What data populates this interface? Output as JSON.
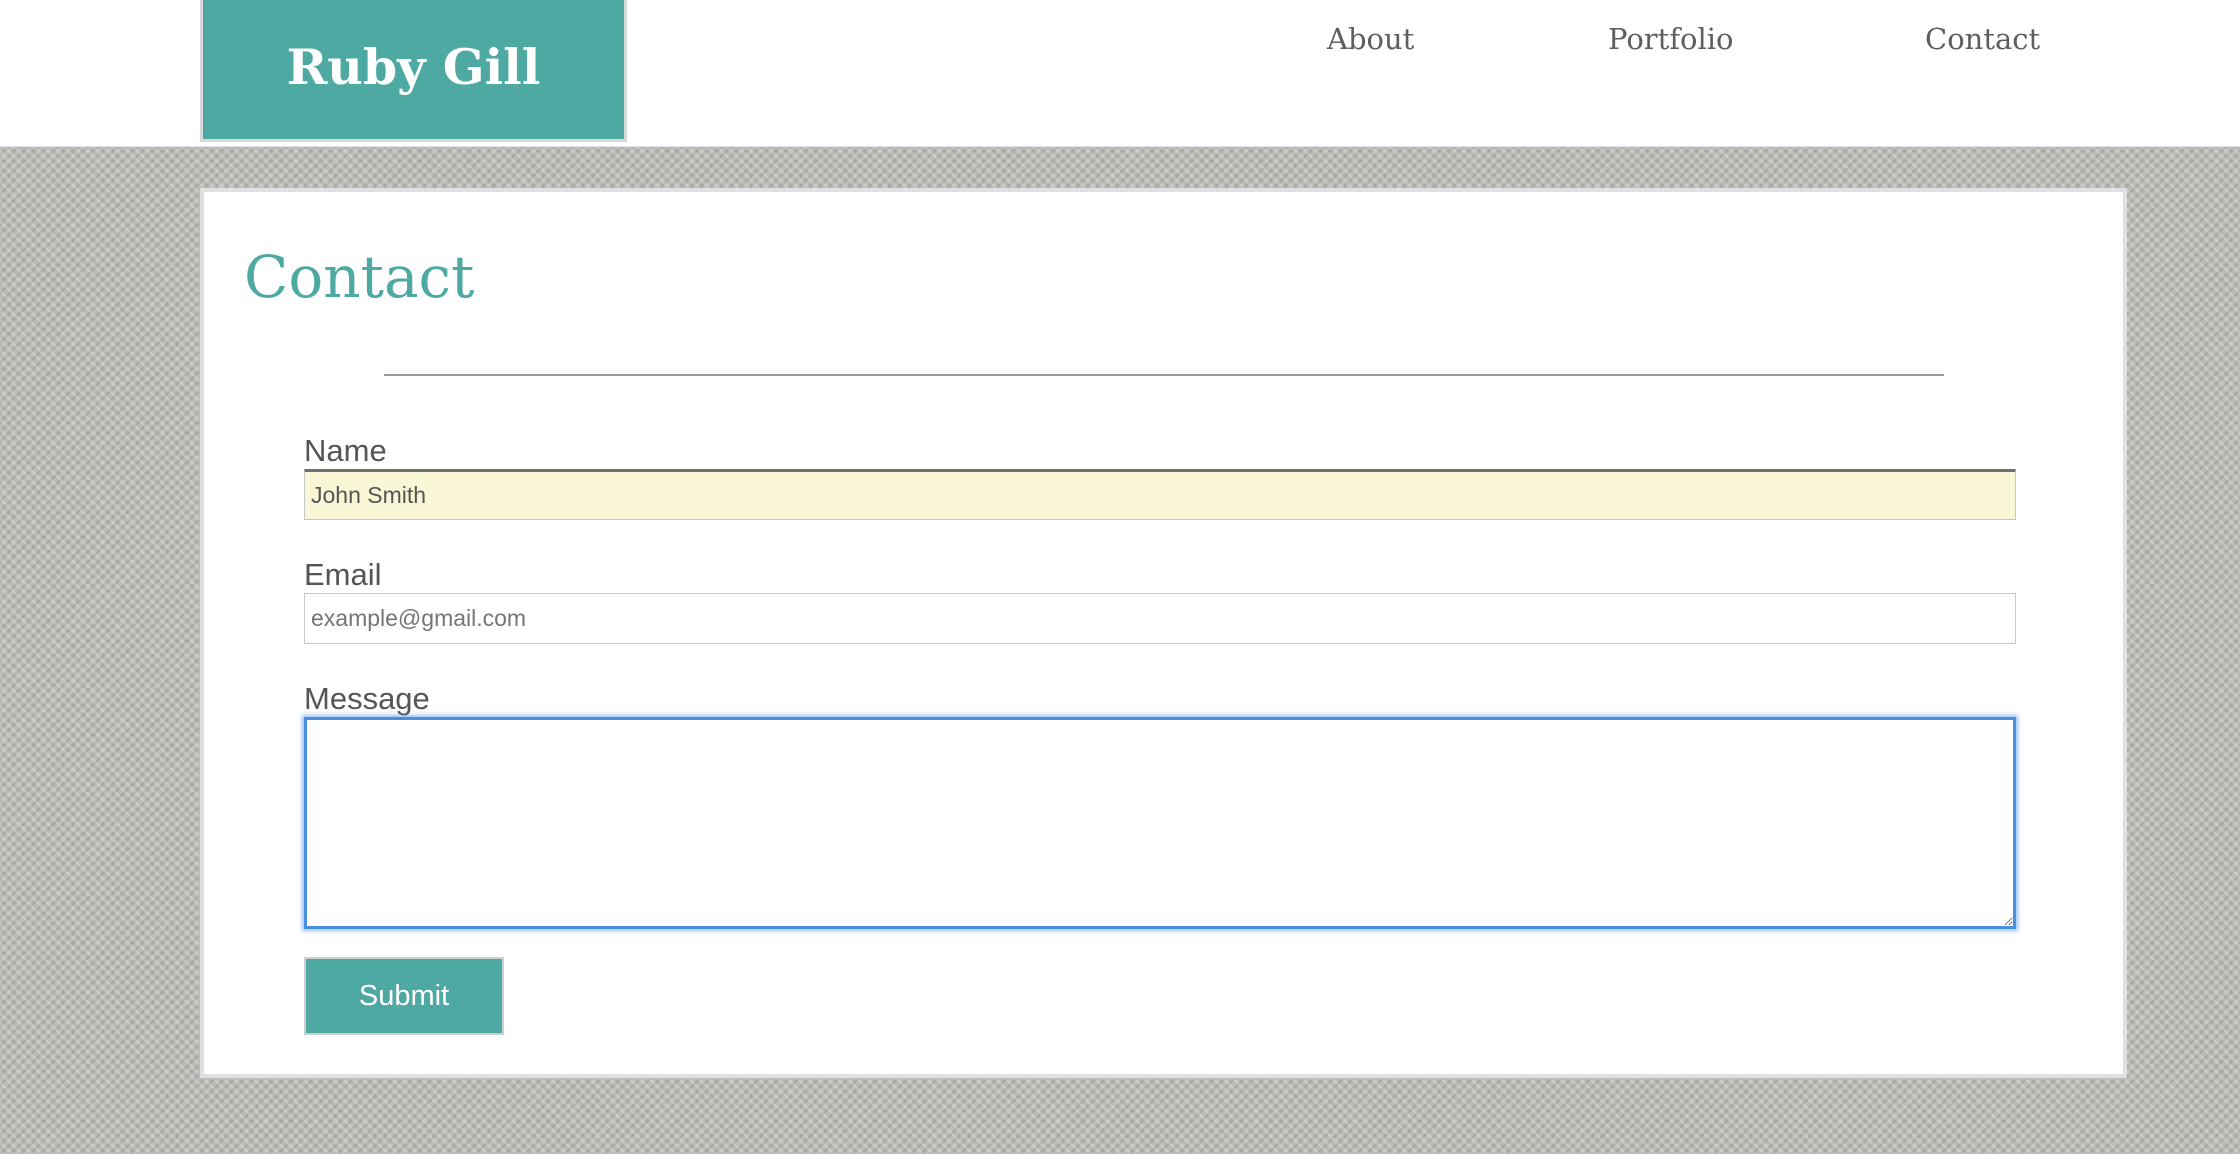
{
  "header": {
    "logo_text": "Ruby Gill",
    "nav": [
      {
        "label": "About"
      },
      {
        "label": "Portfolio"
      },
      {
        "label": "Contact"
      }
    ]
  },
  "main": {
    "title": "Contact",
    "form": {
      "name_label": "Name",
      "name_value": "John Smith",
      "email_label": "Email",
      "email_placeholder": "example@gmail.com",
      "message_label": "Message",
      "message_value": "",
      "submit_label": "Submit"
    }
  },
  "colors": {
    "accent": "#4fa9a3",
    "autofill_background": "#faf7d6",
    "focus_ring": "#4a90e2"
  }
}
